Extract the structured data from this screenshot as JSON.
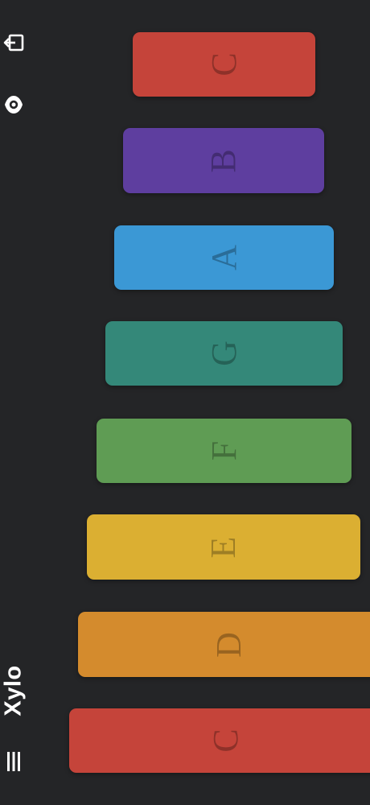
{
  "app": {
    "title": "Xylo"
  },
  "toolbar": {
    "icons": [
      "exit-icon",
      "eye-icon",
      "menu-icon"
    ]
  },
  "keys": [
    {
      "label": "C",
      "color": "#c5443a"
    },
    {
      "label": "B",
      "color": "#5e3e9f"
    },
    {
      "label": "A",
      "color": "#3b98d5"
    },
    {
      "label": "G",
      "color": "#348879"
    },
    {
      "label": "F",
      "color": "#5f9c54"
    },
    {
      "label": "E",
      "color": "#dbaf32"
    },
    {
      "label": "D",
      "color": "#d48b2d"
    },
    {
      "label": "C",
      "color": "#c5443a"
    }
  ]
}
